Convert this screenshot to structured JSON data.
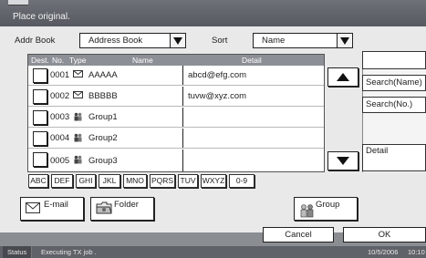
{
  "title_bar": {
    "title": "Place original."
  },
  "filter_bar": {
    "addr_book_label": "Addr Book",
    "addr_book_value": "Address Book",
    "sort_label": "Sort",
    "sort_value": "Name"
  },
  "list": {
    "headers": {
      "dest": "Dest.",
      "no": "No.",
      "type": "Type",
      "name": "Name",
      "detail": "Detail"
    },
    "rows": [
      {
        "no": "0001",
        "type_icon": "email-icon",
        "name": "AAAAA",
        "detail": "abcd@efg.com"
      },
      {
        "no": "0002",
        "type_icon": "email-icon",
        "name": "BBBBB",
        "detail": "tuvw@xyz.com"
      },
      {
        "no": "0003",
        "type_icon": "group-icon",
        "name": "Group1",
        "detail": ""
      },
      {
        "no": "0004",
        "type_icon": "group-icon",
        "name": "Group2",
        "detail": ""
      },
      {
        "no": "0005",
        "type_icon": "group-icon",
        "name": "Group3",
        "detail": ""
      }
    ]
  },
  "right_panel": {
    "search_name": "Search(Name)",
    "search_no": "Search(No.)",
    "detail": "Detail"
  },
  "alpha_tabs": [
    "ABC",
    "DEF",
    "GHI",
    "JKL",
    "MNO",
    "PQRS",
    "TUV",
    "WXYZ",
    "0-9"
  ],
  "buttons": {
    "email": "E-mail",
    "folder": "Folder",
    "group": "Group",
    "cancel": "Cancel",
    "ok": "OK"
  },
  "status_bar": {
    "status_label": "Status",
    "message": "Executing TX job .",
    "date": "10/5/2006",
    "time": "10:10"
  }
}
